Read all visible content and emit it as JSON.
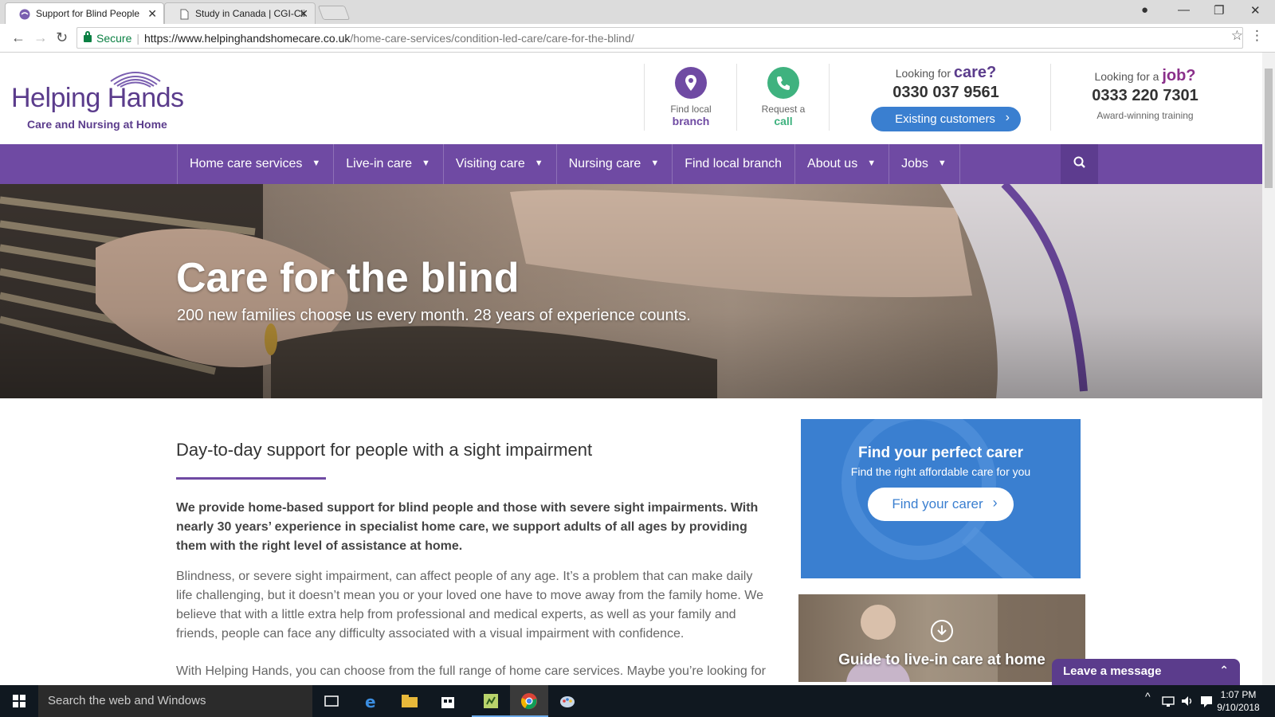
{
  "browser": {
    "tabs": [
      {
        "title": "Support for Blind People",
        "close": "✕",
        "active": true
      },
      {
        "title": "Study in Canada | CGI-Cli",
        "close": "✕",
        "active": false
      }
    ],
    "window_controls": {
      "account": "●",
      "minimize": "—",
      "restore": "❐",
      "close": "✕"
    },
    "nav": {
      "back": "←",
      "forward": "→",
      "reload": "↻"
    },
    "security_label": "Secure",
    "url_host": "https://www.helpinghandshomecare.co.uk",
    "url_path": "/home-care-services/condition-led-care/care-for-the-blind/",
    "bookmark_icon": "☆",
    "menu_icon": "⋮"
  },
  "header": {
    "logo_title": "Helping Hands",
    "logo_subtitle": "Care and Nursing at Home",
    "find_branch": {
      "line1": "Find local",
      "line2": "branch"
    },
    "request_call": {
      "line1": "Request a",
      "line2": "call"
    },
    "care": {
      "prefix": "Looking for",
      "highlight": "care?",
      "phone": "0330 037 9561",
      "button": "Existing customers",
      "button_chevron": "›"
    },
    "job": {
      "prefix": "Looking for a",
      "highlight": "job?",
      "phone": "0333 220 7301",
      "note": "Award-winning training"
    }
  },
  "nav": {
    "items": [
      {
        "label": "Home care services",
        "dropdown": true
      },
      {
        "label": "Live-in care",
        "dropdown": true
      },
      {
        "label": "Visiting care",
        "dropdown": true
      },
      {
        "label": "Nursing care",
        "dropdown": true
      },
      {
        "label": "Find local branch",
        "dropdown": false
      },
      {
        "label": "About us",
        "dropdown": true
      },
      {
        "label": "Jobs",
        "dropdown": true
      }
    ],
    "caret": "▼"
  },
  "hero": {
    "title": "Care for the blind",
    "subtitle": "200 new families choose us every month. 28 years of experience counts."
  },
  "content": {
    "heading": "Day-to-day support for people with a sight impairment",
    "intro": "We provide home-based support for blind people and those with severe sight impairments. With nearly 30 years’ experience in specialist home care, we support adults of all ages by providing them with the right level of assistance at home.",
    "para1": "Blindness, or severe sight impairment, can affect people of any age. It’s a problem that can make daily life challenging, but it doesn’t mean you or your loved one have to move away from the family home. We believe that with a little extra help from professional and medical experts, as well as your family and friends, people can face any difficulty associated with a visual impairment with confidence.",
    "para2": "With Helping Hands, you can choose from the full range of home care services. Maybe you’re looking for"
  },
  "sidebar": {
    "carer_title": "Find your perfect carer",
    "carer_sub": "Find the right affordable care for you",
    "carer_button": "Find your carer",
    "carer_chevron": "›",
    "guide_title": "Guide to live-in care at home"
  },
  "chat": {
    "label": "Leave a message",
    "toggle": "⌃"
  },
  "taskbar": {
    "search_placeholder": "Search the web and Windows",
    "time": "1:07 PM",
    "date": "9/10/2018",
    "tray_caret": "^"
  },
  "colors": {
    "brand_purple": "#6f4aa3",
    "brand_blue": "#3a7fd0",
    "call_green": "#3fb27f",
    "job_magenta": "#8a2f8a"
  }
}
